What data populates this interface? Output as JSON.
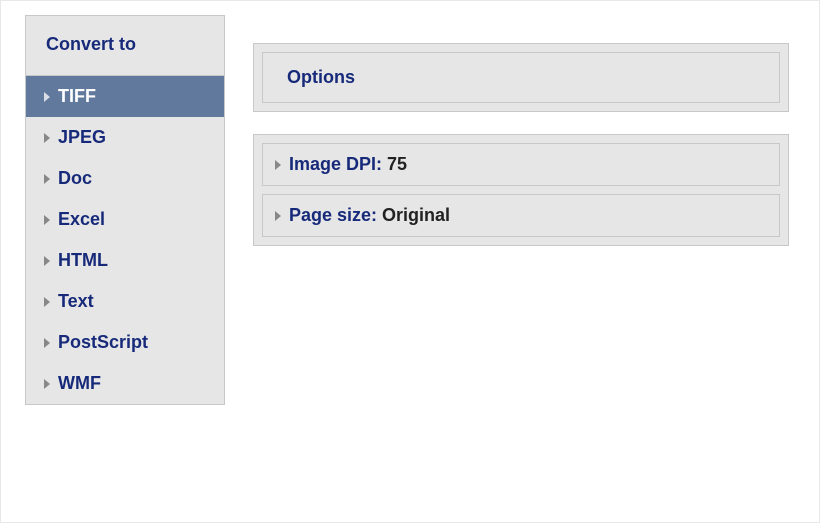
{
  "sidebar": {
    "header": "Convert to",
    "items": [
      {
        "label": "TIFF",
        "selected": true
      },
      {
        "label": "JPEG",
        "selected": false
      },
      {
        "label": "Doc",
        "selected": false
      },
      {
        "label": "Excel",
        "selected": false
      },
      {
        "label": "HTML",
        "selected": false
      },
      {
        "label": "Text",
        "selected": false
      },
      {
        "label": "PostScript",
        "selected": false
      },
      {
        "label": "WMF",
        "selected": false
      }
    ]
  },
  "options": {
    "header": "Options",
    "rows": [
      {
        "label": "Image DPI: ",
        "value": "75"
      },
      {
        "label": "Page size: ",
        "value": "Original"
      }
    ]
  }
}
